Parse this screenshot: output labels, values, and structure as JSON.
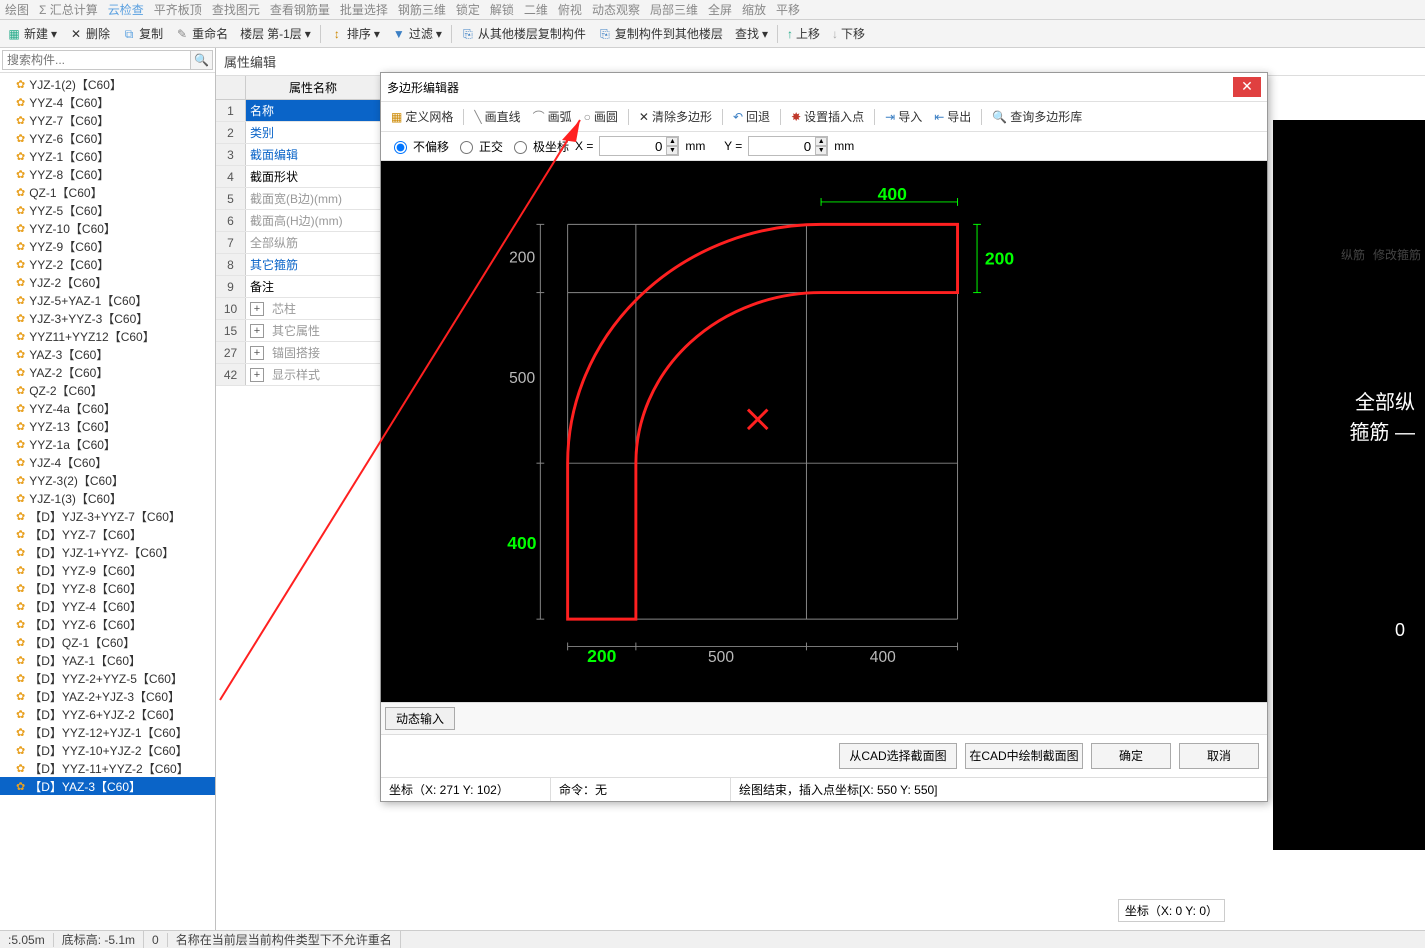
{
  "top_toolbar": {
    "items": [
      "绘图",
      "Σ 汇总计算",
      "云检查",
      "平齐板顶",
      "查找图元",
      "查看钢筋量",
      "批量选择",
      "钢筋三维",
      "锁定",
      "解锁",
      "二维",
      "俯视",
      "动态观察",
      "局部三维",
      "全屏",
      "缩放",
      "平移"
    ]
  },
  "second_toolbar": {
    "new": "新建",
    "delete": "删除",
    "copy": "复制",
    "rename": "重命名",
    "floor_label": "楼层",
    "floor_value": "第-1层",
    "sort": "排序",
    "filter": "过滤",
    "copy_from": "从其他楼层复制构件",
    "copy_to": "复制构件到其他楼层",
    "find": "查找",
    "up": "上移",
    "down": "下移"
  },
  "search_placeholder": "搜索构件...",
  "tree_items": [
    "YJZ-1(2)【C60】",
    "YYZ-4【C60】",
    "YYZ-7【C60】",
    "YYZ-6【C60】",
    "YYZ-1【C60】",
    "YYZ-8【C60】",
    "QZ-1【C60】",
    "YYZ-5【C60】",
    "YYZ-10【C60】",
    "YYZ-9【C60】",
    "YYZ-2【C60】",
    "YJZ-2【C60】",
    "YJZ-5+YAZ-1【C60】",
    "YJZ-3+YYZ-3【C60】",
    "YYZ11+YYZ12【C60】",
    "YAZ-3【C60】",
    "YAZ-2【C60】",
    "QZ-2【C60】",
    "YYZ-4a【C60】",
    "YYZ-13【C60】",
    "YYZ-1a【C60】",
    "YJZ-4【C60】",
    "YYZ-3(2)【C60】",
    "YJZ-1(3)【C60】",
    "【D】YJZ-3+YYZ-7【C60】",
    "【D】YYZ-7【C60】",
    "【D】YJZ-1+YYZ-【C60】",
    "【D】YYZ-9【C60】",
    "【D】YYZ-8【C60】",
    "【D】YYZ-4【C60】",
    "【D】YYZ-6【C60】",
    "【D】QZ-1【C60】",
    "【D】YAZ-1【C60】",
    "【D】YYZ-2+YYZ-5【C60】",
    "【D】YAZ-2+YJZ-3【C60】",
    "【D】YYZ-6+YJZ-2【C60】",
    "【D】YYZ-12+YJZ-1【C60】",
    "【D】YYZ-10+YJZ-2【C60】",
    "【D】YYZ-11+YYZ-2【C60】",
    "【D】YAZ-3【C60】"
  ],
  "tree_selected_index": 39,
  "prop_panel": {
    "title": "属性编辑",
    "header": "属性名称",
    "rows": [
      {
        "idx": "1",
        "label": "名称",
        "style": "sel"
      },
      {
        "idx": "2",
        "label": "类别",
        "style": "blue"
      },
      {
        "idx": "3",
        "label": "截面编辑",
        "style": "blue"
      },
      {
        "idx": "4",
        "label": "截面形状",
        "style": ""
      },
      {
        "idx": "5",
        "label": "截面宽(B边)(mm)",
        "style": "grey"
      },
      {
        "idx": "6",
        "label": "截面高(H边)(mm)",
        "style": "grey"
      },
      {
        "idx": "7",
        "label": "全部纵筋",
        "style": "grey"
      },
      {
        "idx": "8",
        "label": "其它箍筋",
        "style": "blue"
      },
      {
        "idx": "9",
        "label": "备注",
        "style": ""
      },
      {
        "idx": "10",
        "label": "芯柱",
        "style": "grey",
        "plus": true
      },
      {
        "idx": "15",
        "label": "其它属性",
        "style": "grey",
        "plus": true
      },
      {
        "idx": "27",
        "label": "锚固搭接",
        "style": "grey",
        "plus": true
      },
      {
        "idx": "42",
        "label": "显示样式",
        "style": "grey",
        "plus": true
      }
    ]
  },
  "dialog": {
    "title": "多边形编辑器",
    "tb": {
      "define_grid": "定义网格",
      "line": "画直线",
      "arc": "画弧",
      "circle": "画圆",
      "clear": "清除多边形",
      "undo": "回退",
      "insert_pt": "设置插入点",
      "import": "导入",
      "export": "导出",
      "query": "查询多边形库"
    },
    "mode": {
      "no_offset": "不偏移",
      "ortho": "正交",
      "polar": "极坐标"
    },
    "x_label": "X =",
    "x_value": "0",
    "y_label": "Y =",
    "y_value": "0",
    "unit": "mm",
    "dynamic_input": "动态输入",
    "btn_cad_select": "从CAD选择截面图",
    "btn_cad_draw": "在CAD中绘制截面图",
    "btn_ok": "确定",
    "btn_cancel": "取消",
    "status_coord": "坐标（X: 271 Y: 102）",
    "status_cmd": "命令：无",
    "status_result": "绘图结束，插入点坐标[X: 550 Y: 550]"
  },
  "canvas_labels": {
    "top_400": "400",
    "right_200": "200",
    "left_200": "200",
    "left_500": "500",
    "left_400": "400",
    "bot_200": "200",
    "bot_500": "500",
    "bot_400": "400"
  },
  "chart_data": {
    "type": "diagram",
    "description": "L-shaped column cross-section with arc transition on a black CAD grid",
    "grid_cols": [
      200,
      500,
      400
    ],
    "grid_rows": [
      200,
      500,
      400
    ],
    "outline_red": true,
    "insert_point": [
      550,
      550
    ]
  },
  "right_strip": {
    "tab1": "纵筋",
    "tab2": "修改箍筋",
    "big1": "全部纵",
    "big2": "箍筋",
    "zero": "0"
  },
  "outer_coord": "坐标（X: 0 Y: 0）",
  "bottom_status": {
    "a": ":5.05m",
    "b": "底标高: -5.1m",
    "c": "0",
    "d": "名称在当前层当前构件类型下不允许重名"
  }
}
